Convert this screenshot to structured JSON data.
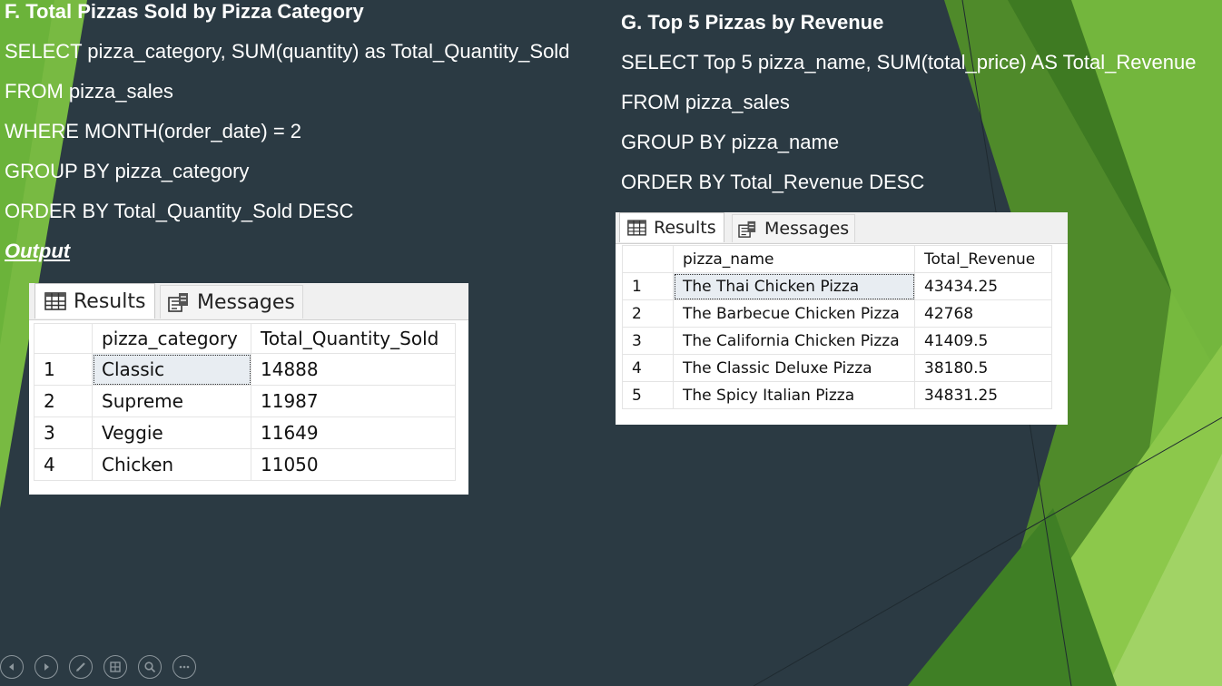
{
  "colors": {
    "background": "#2b3a43",
    "accent_green": "#7cc142",
    "dark_green": "#4f8a2a",
    "text": "#ffffff"
  },
  "section_f": {
    "title": "F. Total Pizzas Sold by Pizza Category",
    "sql_lines": [
      "SELECT pizza_category, SUM(quantity) as Total_Quantity_Sold",
      "FROM pizza_sales",
      "WHERE MONTH(order_date) = 2",
      "GROUP BY pizza_category",
      "ORDER BY Total_Quantity_Sold DESC"
    ],
    "output_label": "Output",
    "results": {
      "tabs": [
        {
          "label": "Results",
          "icon": "grid-icon"
        },
        {
          "label": "Messages",
          "icon": "messages-icon"
        }
      ],
      "columns": [
        "pizza_category",
        "Total_Quantity_Sold"
      ],
      "rows": [
        {
          "num": "1",
          "cells": [
            "Classic",
            "14888"
          ]
        },
        {
          "num": "2",
          "cells": [
            "Supreme",
            "11987"
          ]
        },
        {
          "num": "3",
          "cells": [
            "Veggie",
            "11649"
          ]
        },
        {
          "num": "4",
          "cells": [
            "Chicken",
            "11050"
          ]
        }
      ]
    }
  },
  "section_g": {
    "title": "G. Top 5 Pizzas by Revenue",
    "sql_lines": [
      "SELECT Top 5 pizza_name, SUM(total_price) AS Total_Revenue",
      "FROM pizza_sales",
      "GROUP BY pizza_name",
      "ORDER BY Total_Revenue DESC"
    ],
    "results": {
      "tabs": [
        {
          "label": "Results",
          "icon": "grid-icon"
        },
        {
          "label": "Messages",
          "icon": "messages-icon"
        }
      ],
      "columns": [
        "pizza_name",
        "Total_Revenue"
      ],
      "rows": [
        {
          "num": "1",
          "cells": [
            "The Thai Chicken Pizza",
            "43434.25"
          ]
        },
        {
          "num": "2",
          "cells": [
            "The Barbecue Chicken Pizza",
            "42768"
          ]
        },
        {
          "num": "3",
          "cells": [
            "The California Chicken Pizza",
            "41409.5"
          ]
        },
        {
          "num": "4",
          "cells": [
            "The Classic Deluxe Pizza",
            "38180.5"
          ]
        },
        {
          "num": "5",
          "cells": [
            "The Spicy Italian Pizza",
            "34831.25"
          ]
        }
      ]
    }
  },
  "slideshow_controls": [
    {
      "name": "previous-slide-button",
      "icon": "arrow-left-icon"
    },
    {
      "name": "next-slide-button",
      "icon": "arrow-right-icon"
    },
    {
      "name": "pen-tool-button",
      "icon": "pen-icon"
    },
    {
      "name": "see-all-slides-button",
      "icon": "slides-icon"
    },
    {
      "name": "zoom-button",
      "icon": "magnifier-icon"
    },
    {
      "name": "more-options-button",
      "icon": "ellipsis-icon"
    }
  ]
}
